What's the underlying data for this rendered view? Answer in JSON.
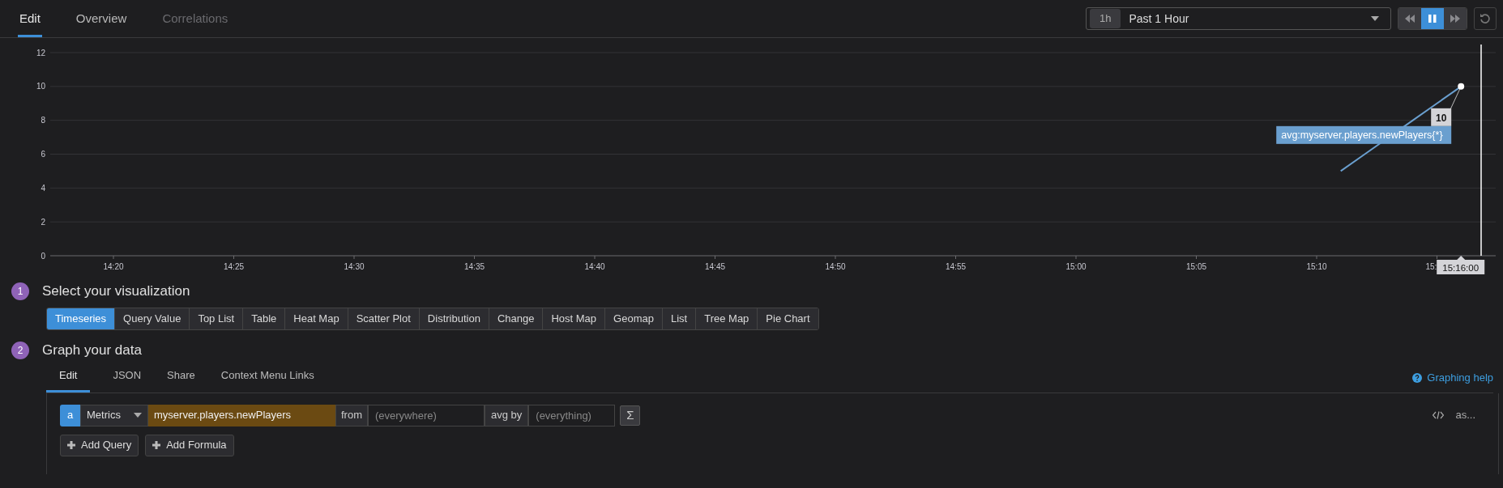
{
  "tabs": [
    {
      "label": "Edit",
      "selected": true,
      "disabled": false
    },
    {
      "label": "Overview",
      "selected": false,
      "disabled": false
    },
    {
      "label": "Correlations",
      "selected": false,
      "disabled": true
    }
  ],
  "time_range": {
    "badge": "1h",
    "label": "Past 1 Hour"
  },
  "playback": [
    {
      "kind": "rewind",
      "selected": false
    },
    {
      "kind": "pause",
      "selected": true
    },
    {
      "kind": "forward",
      "selected": false
    }
  ],
  "chart": {
    "chart_data": {
      "type": "line",
      "categories": [
        null,
        null,
        "14:20",
        null,
        null,
        null,
        null,
        "14:25",
        null,
        null,
        null,
        null,
        "14:30",
        null,
        null,
        null,
        null,
        "14:35",
        null,
        null,
        null,
        null,
        "14:40",
        null,
        null,
        null,
        null,
        "14:45",
        null,
        null,
        null,
        null,
        "14:50",
        null,
        null,
        null,
        null,
        "14:55",
        null,
        null,
        null,
        null,
        "15:00",
        null,
        null,
        null,
        null,
        "15:05",
        null,
        null,
        null,
        null,
        "15:10",
        null,
        null,
        null,
        null,
        null,
        null,
        null
      ],
      "series": [
        {
          "name": "avg:myserver.players.newPlayers{*}",
          "color": "#6a9fcf",
          "values": [
            null,
            null,
            null,
            null,
            null,
            null,
            null,
            null,
            null,
            null,
            null,
            null,
            null,
            null,
            null,
            null,
            null,
            null,
            null,
            null,
            null,
            null,
            null,
            null,
            null,
            null,
            null,
            null,
            null,
            null,
            null,
            null,
            null,
            null,
            null,
            null,
            null,
            null,
            null,
            null,
            null,
            null,
            null,
            null,
            null,
            null,
            null,
            null,
            null,
            null,
            null,
            null,
            null,
            5,
            6,
            null,
            8,
            9,
            10,
            null
          ]
        }
      ],
      "ylim": [
        0,
        12
      ],
      "yticks": [
        0,
        2,
        4,
        6,
        8,
        10,
        12
      ],
      "grid": true
    },
    "cut_tick_label": "15:",
    "hover": {
      "value": "10",
      "time": "15:16:00"
    }
  },
  "steps": [
    {
      "number": "1",
      "title": "Select your visualization"
    },
    {
      "number": "2",
      "title": "Graph your data"
    }
  ],
  "visualizations": [
    {
      "label": "Timeseries",
      "selected": true
    },
    {
      "label": "Query Value",
      "selected": false
    },
    {
      "label": "Top List",
      "selected": false
    },
    {
      "label": "Table",
      "selected": false
    },
    {
      "label": "Heat Map",
      "selected": false
    },
    {
      "label": "Scatter Plot",
      "selected": false
    },
    {
      "label": "Distribution",
      "selected": false
    },
    {
      "label": "Change",
      "selected": false
    },
    {
      "label": "Host Map",
      "selected": false
    },
    {
      "label": "Geomap",
      "selected": false
    },
    {
      "label": "List",
      "selected": false
    },
    {
      "label": "Tree Map",
      "selected": false
    },
    {
      "label": "Pie Chart",
      "selected": false
    }
  ],
  "graph_tabs": [
    {
      "label": "Edit",
      "selected": true
    },
    {
      "label": "JSON",
      "selected": false
    },
    {
      "label": "Share",
      "selected": false
    },
    {
      "label": "Context Menu Links",
      "selected": false
    }
  ],
  "help_link": "Graphing help",
  "query": {
    "letter": "a",
    "source": "Metrics",
    "metric": "myserver.players.newPlayers",
    "from_label": "from",
    "from_placeholder": "(everywhere)",
    "agg_label": "avg by",
    "agg_placeholder": "(everything)",
    "sigma": "Σ",
    "more": "as..."
  },
  "buttons": [
    "Add Query",
    "Add Formula"
  ]
}
